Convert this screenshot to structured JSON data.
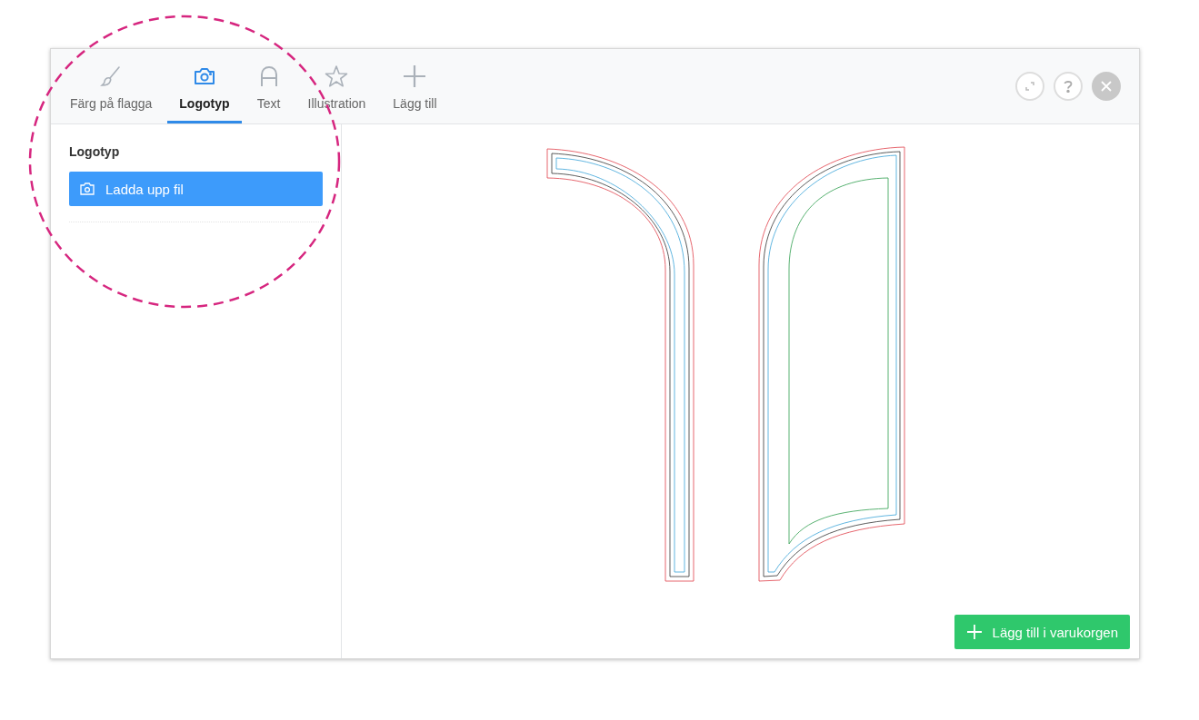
{
  "tabs": [
    {
      "label": "Färg på flagga",
      "kind": "brush",
      "selected": false
    },
    {
      "label": "Logotyp",
      "kind": "camera",
      "selected": true
    },
    {
      "label": "Text",
      "kind": "letter",
      "selected": false
    },
    {
      "label": "Illustration",
      "kind": "star",
      "selected": false
    },
    {
      "label": "Lägg till",
      "kind": "plus",
      "selected": false
    }
  ],
  "window_controls": [
    {
      "kind": "expand"
    },
    {
      "kind": "help"
    },
    {
      "kind": "close"
    }
  ],
  "sidebar": {
    "title": "Logotyp",
    "upload_button": "Ladda upp fil"
  },
  "cart_button": "Lägg till i varukorgen"
}
